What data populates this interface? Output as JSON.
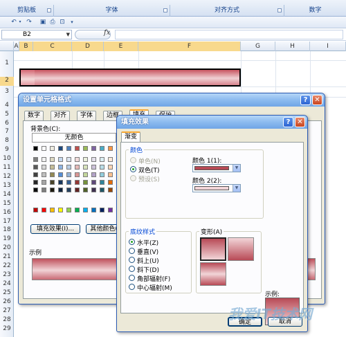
{
  "ribbon": {
    "groups": [
      "剪贴板",
      "字体",
      "对齐方式",
      "数字"
    ]
  },
  "formula_bar": {
    "name_box": "B2",
    "fx_label": "fx"
  },
  "sheet": {
    "columns": [
      "A",
      "B",
      "C",
      "D",
      "E",
      "F",
      "G",
      "H",
      "I"
    ],
    "rows": [
      "1",
      "2",
      "3",
      "4",
      "5",
      "6",
      "7",
      "8",
      "9",
      "10",
      "11",
      "12",
      "13",
      "14",
      "15",
      "16",
      "17",
      "18",
      "19",
      "20",
      "21",
      "22",
      "23",
      "24",
      "25",
      "26",
      "27",
      "28",
      "29"
    ]
  },
  "format_cells_dialog": {
    "title": "设置单元格格式",
    "tabs": [
      "数字",
      "对齐",
      "字体",
      "边框",
      "填充",
      "保护"
    ],
    "active_tab": "填充",
    "background_color_label": "背景色(C):",
    "no_color_label": "无颜色",
    "fill_effects_button": "填充效果(I)...",
    "more_colors_button": "其他颜色(M)...",
    "sample_label": "示例"
  },
  "fill_effects_dialog": {
    "title": "填充效果",
    "tab": "渐变",
    "colors_group": "颜色",
    "color_options": [
      {
        "label": "单色(N)",
        "enabled": false,
        "checked": false
      },
      {
        "label": "双色(T)",
        "enabled": true,
        "checked": true
      },
      {
        "label": "预设(S)",
        "enabled": false,
        "checked": false
      }
    ],
    "color1_label": "颜色 1(1):",
    "color2_label": "颜色 2(2):",
    "color1": "#b84a56",
    "color2": "#f2d5d8",
    "shading_group": "底纹样式",
    "shading_styles": [
      {
        "label": "水平(Z)",
        "checked": true
      },
      {
        "label": "垂直(V)",
        "checked": false
      },
      {
        "label": "斜上(U)",
        "checked": false
      },
      {
        "label": "斜下(D)",
        "checked": false
      },
      {
        "label": "角部辐射(F)",
        "checked": false
      },
      {
        "label": "中心辐射(M)",
        "checked": false
      }
    ],
    "variants_label": "变形(A)",
    "sample_label": "示例:",
    "ok_button": "确定",
    "cancel_button": "取消"
  },
  "watermark": "我爱IT技术网"
}
